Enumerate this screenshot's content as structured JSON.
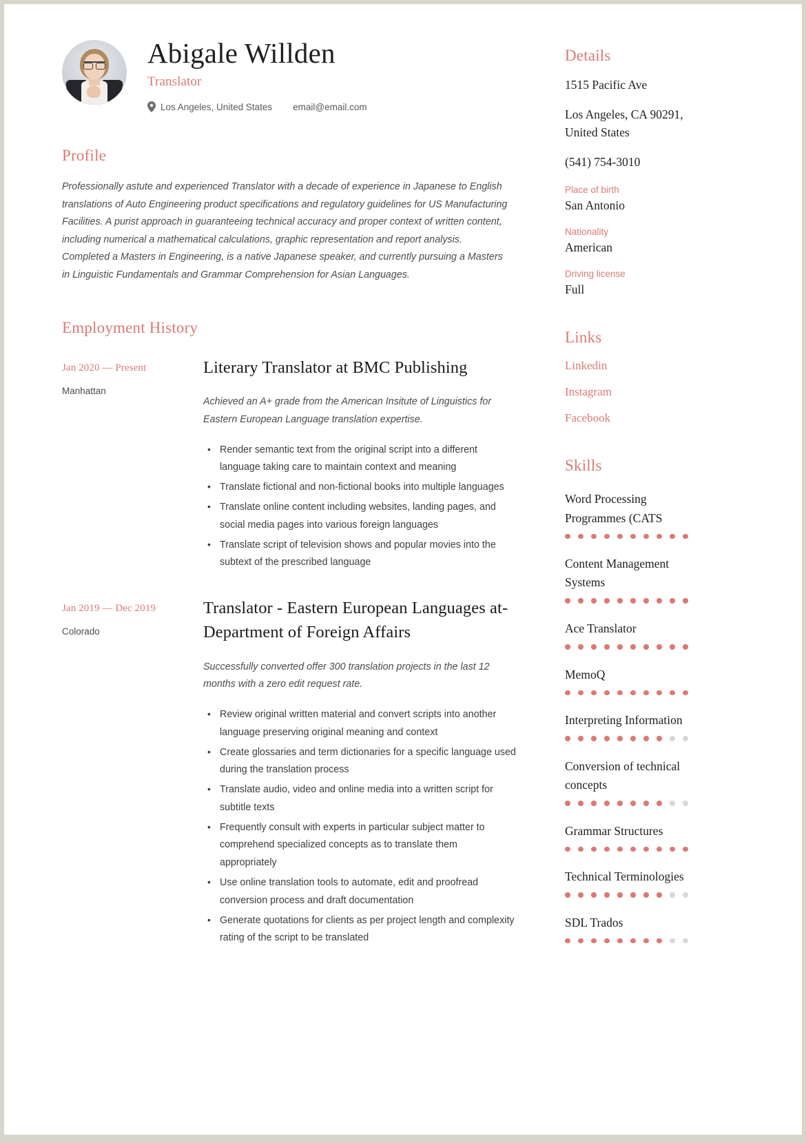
{
  "theme": {
    "accent": "#d97b74",
    "text": "#1f1f1f",
    "muted": "#4c4c4c",
    "dot_off": "#d8d8d8"
  },
  "header": {
    "name": "Abigale Willden",
    "job_title": "Translator",
    "location": "Los Angeles, United States",
    "email": "email@email.com",
    "location_icon": "map-pin-icon",
    "avatar_alt": "profile-photo"
  },
  "profile": {
    "heading": "Profile",
    "text": "Professionally astute and experienced Translator with a decade of experience in Japanese to English translations of Auto Engineering product specifications and regulatory guidelines for US Manufacturing Facilities. A purist approach in guaranteeing technical accuracy and proper context of written content, including numerical a mathematical calculations, graphic representation and report analysis. Completed a Masters in Engineering, is a native Japanese speaker, and currently pursuing a Masters in Linguistic Fundamentals and Grammar Comprehension for Asian Languages."
  },
  "employment": {
    "heading": "Employment History",
    "jobs": [
      {
        "period": "Jan 2020 — Present",
        "place": "Manhattan",
        "role": "Literary Translator at  BMC Publishing",
        "summary": "Achieved an A+ grade from the American Insitute of Linguistics for Eastern European Language translation expertise.",
        "bullets": [
          "Render semantic text from the original script into a different language taking care to maintain context and meaning",
          "Translate fictional and non-fictional books into multiple languages",
          "Translate online content including websites, landing pages, and social media pages into various foreign languages",
          "Translate script of television shows and popular movies into the subtext of the prescribed language"
        ]
      },
      {
        "period": "Jan 2019 — Dec 2019",
        "place": "Colorado",
        "role": "Translator - Eastern European Languages at- Department of Foreign Affairs",
        "summary": "Successfully converted offer 300 translation projects in the last 12 months with a zero edit request rate.",
        "bullets": [
          "Review original written material and convert scripts into another language preserving original meaning and context",
          "Create glossaries and term dictionaries for a specific language used during the translation process",
          "Translate audio, video and online media into a written script for subtitle texts",
          "Frequently consult with experts in particular subject matter to comprehend specialized concepts as to translate them appropriately",
          "Use online translation tools to automate, edit and proofread conversion process and draft documentation",
          "Generate quotations for clients as per project length and complexity rating of the script to be translated"
        ]
      }
    ]
  },
  "details": {
    "heading": "Details",
    "address_line1": "1515 Pacific Ave",
    "address_line2": "Los Angeles, CA 90291, United States",
    "phone": "(541) 754-3010",
    "fields": [
      {
        "label": "Place of birth",
        "value": "San Antonio"
      },
      {
        "label": "Nationality",
        "value": "American"
      },
      {
        "label": "Driving license",
        "value": "Full"
      }
    ]
  },
  "links": {
    "heading": "Links",
    "items": [
      {
        "label": "Linkedin"
      },
      {
        "label": "Instagram"
      },
      {
        "label": "Facebook"
      }
    ]
  },
  "skills": {
    "heading": "Skills",
    "max_level": 10,
    "items": [
      {
        "name": "Word Processing Programmes (CATS",
        "level": 10
      },
      {
        "name": "Content Management Systems",
        "level": 10
      },
      {
        "name": "Ace Translator",
        "level": 10
      },
      {
        "name": "MemoQ",
        "level": 10
      },
      {
        "name": "Interpreting Information",
        "level": 8
      },
      {
        "name": "Conversion of technical concepts",
        "level": 8
      },
      {
        "name": "Grammar Structures",
        "level": 10
      },
      {
        "name": "Technical Terminologies",
        "level": 8
      },
      {
        "name": "SDL Trados",
        "level": 8
      }
    ]
  }
}
